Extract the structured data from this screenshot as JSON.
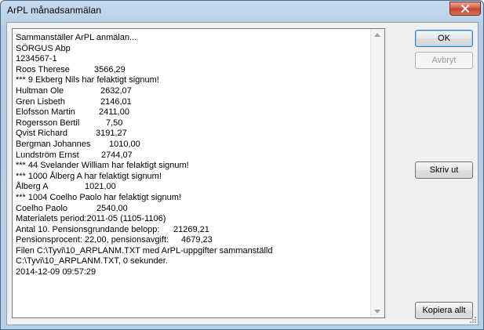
{
  "window": {
    "title": "ArPL månadsanmälan"
  },
  "log": {
    "lines": [
      {
        "label": "Sammanställer ArPL anmälan...",
        "value": ""
      },
      {
        "label": "SÖRGUS Abp",
        "value": ""
      },
      {
        "label": "1234567-1",
        "value": ""
      },
      {
        "label": "Roos Therese",
        "value": "3566,29"
      },
      {
        "label": "*** 9 Ekberg Nils har felaktigt signum!",
        "value": ""
      },
      {
        "label": "Hultman Ole",
        "value": "2632,07"
      },
      {
        "label": "Gren Lisbeth",
        "value": "2146,01"
      },
      {
        "label": "Elofsson Martin",
        "value": "2411,00"
      },
      {
        "label": "Rogersson Bertil",
        "value": "7,50"
      },
      {
        "label": "Qvist Richard",
        "value": "3191,27"
      },
      {
        "label": "Bergman Johannes",
        "value": "1010,00"
      },
      {
        "label": "Lundström Ernst",
        "value": "2744,07"
      },
      {
        "label": "*** 44 Svelander William har felaktigt signum!",
        "value": ""
      },
      {
        "label": "*** 1000 Ålberg A har felaktigt signum!",
        "value": ""
      },
      {
        "label": "Ålberg A",
        "value": "1021,00"
      },
      {
        "label": "*** 1004 Coelho Paolo har felaktigt signum!",
        "value": ""
      },
      {
        "label": "Coelho Paolo",
        "value": "2540,00"
      },
      {
        "label": "Materialets period:2011-05 (1105-1106)",
        "value": ""
      },
      {
        "label": "Antal 10. Pensionsgrundande belopp:",
        "value": "21269,21"
      },
      {
        "label": "Pensionsprocent: 22,00, pensionsavgift:",
        "value": "4679,23"
      },
      {
        "label": "Filen C:\\Tyvi\\10_ARPLANM.TXT med ArPL-uppgifter sammanställd",
        "value": ""
      },
      {
        "label": "C:\\Tyvi\\10_ARPLANM.TXT, 0 sekunder.",
        "value": ""
      },
      {
        "label": "2014-12-09 09:57:29",
        "value": ""
      }
    ]
  },
  "buttons": {
    "ok": "OK",
    "cancel": "Avbryt",
    "print": "Skriv ut",
    "copy_all": "Kopiera allt"
  },
  "icons": {
    "close": "close-icon",
    "scroll_up": "scroll-up-arrow-icon",
    "scroll_down": "scroll-down-arrow-icon",
    "resize": "resize-grip-icon"
  }
}
